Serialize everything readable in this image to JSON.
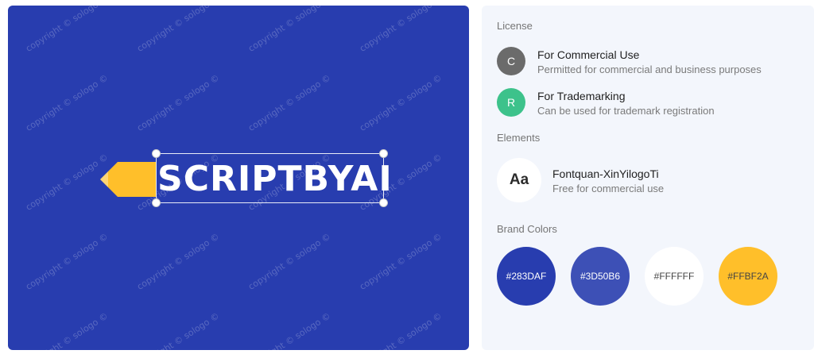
{
  "preview": {
    "watermark_text": "copyright © sologo ©",
    "logo_text": "SCRIPTBYAI",
    "background": "#283DAF",
    "accent": "#FFBF2A"
  },
  "license": {
    "title": "License",
    "items": [
      {
        "badge": "C",
        "badge_color": "#6b6b6b",
        "title": "For Commercial Use",
        "subtitle": "Permitted for commercial and business purposes"
      },
      {
        "badge": "R",
        "badge_color": "#3DC28B",
        "title": "For Trademarking",
        "subtitle": "Can be used for trademark registration"
      }
    ]
  },
  "elements": {
    "title": "Elements",
    "font": {
      "glyph": "Aa",
      "name": "Fontquan-XinYilogoTi",
      "note": "Free for commercial use"
    }
  },
  "brand_colors": {
    "title": "Brand Colors",
    "colors": [
      {
        "hex": "#283DAF",
        "label": "#283DAF",
        "text_color": "#ffffff"
      },
      {
        "hex": "#3D50B6",
        "label": "#3D50B6",
        "text_color": "#ffffff"
      },
      {
        "hex": "#FFFFFF",
        "label": "#FFFFFF",
        "text_color": "#444444"
      },
      {
        "hex": "#FFBF2A",
        "label": "#FFBF2A",
        "text_color": "#444444"
      }
    ]
  }
}
